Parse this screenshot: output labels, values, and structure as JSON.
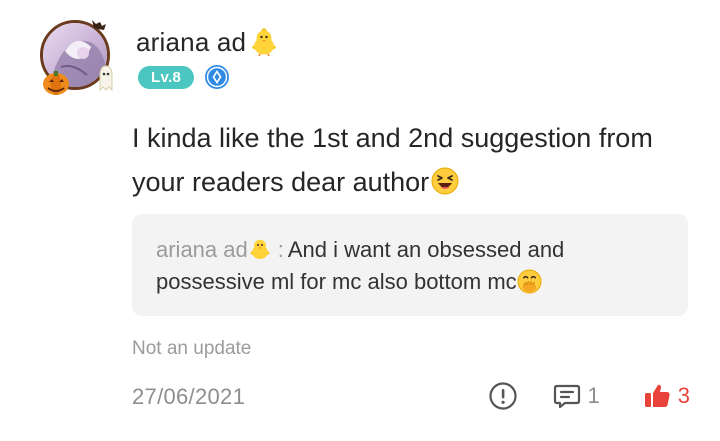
{
  "user": {
    "name": "ariana ad",
    "level": "Lv.8"
  },
  "comment": {
    "text": "I kinda like the 1st and 2nd suggestion from your readers dear author",
    "tag": "Not an update",
    "date": "27/06/2021"
  },
  "quote": {
    "author": "ariana ad",
    "separator": ":",
    "text": "And i want an obsessed and possessive ml for mc also bottom mc"
  },
  "stats": {
    "replies": "1",
    "likes": "3"
  },
  "icons": {
    "avatar": "halloween-avatar-frame",
    "name_emoji": "baby-chick-icon",
    "rank": "diamond-rank-icon",
    "body_emoji": "laughing-face-icon",
    "quote_emoji": "face-with-hand-over-mouth-icon",
    "report": "exclamation-circle-icon",
    "reply": "comment-bubble-icon",
    "like": "thumbs-up-icon"
  },
  "colors": {
    "level_badge": "#4cc6c0",
    "rank_badge": "#2f8be6",
    "like_active": "#e8423a",
    "muted_text": "#8e8e8e",
    "quote_bg": "#f3f3f3"
  }
}
